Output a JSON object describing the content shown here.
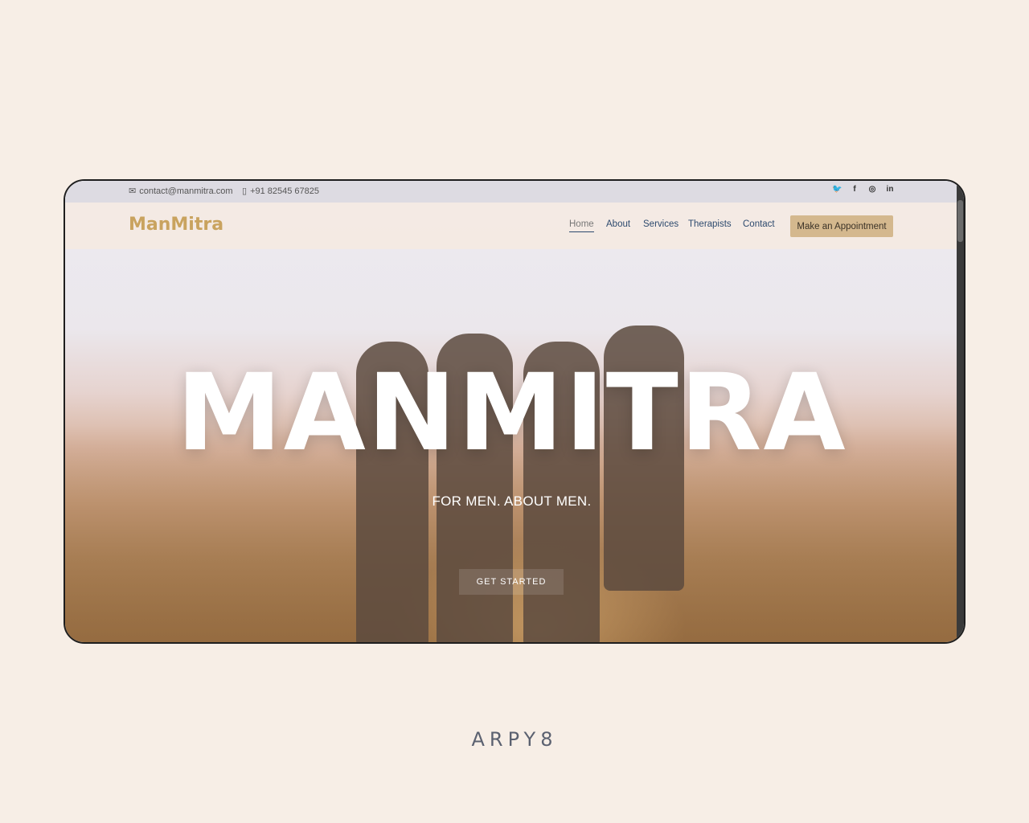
{
  "topbar": {
    "email": "contact@manmitra.com",
    "phone": "+91 82545 67825",
    "socials": [
      "twitter-icon",
      "facebook-icon",
      "instagram-icon",
      "linkedin-icon"
    ]
  },
  "header": {
    "logo": "ManMitra",
    "nav": [
      "Home",
      "About",
      "Services",
      "Therapists",
      "Contact"
    ],
    "active_nav": "Home",
    "cta": "Make an Appointment"
  },
  "hero": {
    "title": "MANMITRA",
    "tagline": "FOR MEN. ABOUT MEN.",
    "button": "GET STARTED"
  },
  "footer_brand": "ARPY8",
  "colors": {
    "page_bg": "#f7eee6",
    "logo": "#c9a35f",
    "nav_text": "#2d4a6e",
    "cta_bg": "#d4b88e",
    "footer_brand": "#5b6170"
  }
}
